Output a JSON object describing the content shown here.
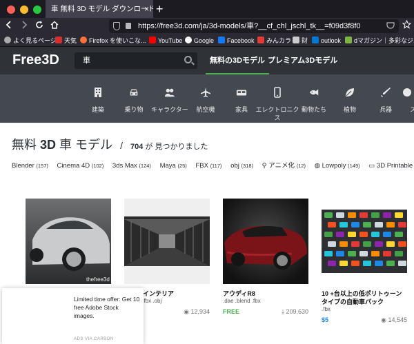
{
  "browser": {
    "tab_title": "車 無料 3D モデル ダウンロード - Fr",
    "tab_close": "×",
    "new_tab": "+",
    "url": "https://free3d.com/ja/3d-models/車?__cf_chl_jschl_tk__=f09d3f8f0",
    "colors": {
      "red": "#ff5f57",
      "yellow": "#febc2e",
      "green": "#28c840"
    }
  },
  "bookmarks": [
    {
      "label": "よく見るページ",
      "icon": "gear-icon",
      "color": "#aaaaaa"
    },
    {
      "label": "天気",
      "icon": "weather-icon",
      "color": "#d32f2f"
    },
    {
      "label": "Firefox を使いこな...",
      "icon": "firefox-icon",
      "color": "#ff7139"
    },
    {
      "label": "YouTube",
      "icon": "youtube-icon",
      "color": "#ff0000"
    },
    {
      "label": "Google",
      "icon": "google-icon",
      "color": "#ffffff"
    },
    {
      "label": "Facebook",
      "icon": "facebook-icon",
      "color": "#1877f2"
    },
    {
      "label": "みんカラ",
      "icon": "minkara-icon",
      "color": "#e53935"
    },
    {
      "label": "財",
      "icon": "folder-icon",
      "color": "#cccccc"
    },
    {
      "label": "outlook",
      "icon": "outlook-icon",
      "color": "#0078d4"
    },
    {
      "label": "dマガジン｜多彩なジ...",
      "icon": "dmagazine-icon",
      "color": "#7cb342"
    }
  ],
  "site": {
    "logo": "Free3D",
    "search_query": "車",
    "nav": [
      "無料の3Dモデル",
      "プレミアム3Dモデル"
    ],
    "accent": "#4caf50"
  },
  "categories": [
    {
      "label": "建築",
      "icon": "building-icon"
    },
    {
      "label": "乗り物",
      "icon": "car-icon"
    },
    {
      "label": "キャラクター",
      "icon": "people-icon"
    },
    {
      "label": "航空機",
      "icon": "airplane-icon"
    },
    {
      "label": "家具",
      "icon": "bed-icon"
    },
    {
      "label": "エレクトロニクス",
      "icon": "phone-icon"
    },
    {
      "label": "動物たち",
      "icon": "fish-icon"
    },
    {
      "label": "植物",
      "icon": "leaf-icon"
    },
    {
      "label": "兵器",
      "icon": "weapon-icon"
    },
    {
      "label": "ス",
      "icon": "sports-icon"
    }
  ],
  "heading": {
    "title_prefix": "無料 ",
    "title_bold": "3D",
    "title_suffix": " 車 モデル",
    "slash": "/",
    "count": "704",
    "found_text": " が 見つかりました"
  },
  "filters": [
    {
      "label": "Blender",
      "count": "(157)",
      "icon": ""
    },
    {
      "label": "Cinema 4D",
      "count": "(102)",
      "icon": ""
    },
    {
      "label": "3ds Max",
      "count": "(124)",
      "icon": ""
    },
    {
      "label": "Maya",
      "count": "(25)",
      "icon": ""
    },
    {
      "label": "FBX",
      "count": "(117)",
      "icon": ""
    },
    {
      "label": "obj",
      "count": "(318)",
      "icon": ""
    },
    {
      "label": "アニメ化",
      "count": "(12)",
      "icon": "running-icon"
    },
    {
      "label": "Lowpoly",
      "count": "(149)",
      "icon": "globe-icon"
    },
    {
      "label": "3D Printable",
      "count": "(",
      "icon": "monitor-icon"
    }
  ],
  "cards": [
    {
      "title": "",
      "formats": "",
      "price": "",
      "views": "",
      "watermark": "thefree3d"
    },
    {
      "title": "電車のインテリア",
      "formats": "vn .ma .fbx .obj",
      "price": "",
      "views": "12,934"
    },
    {
      "title": "アウディR8",
      "formats": ".dae .blend .fbx",
      "price": "FREE",
      "views": "209,630"
    },
    {
      "title": "10 +台以上の低ポリトゥーンタイプの自動車パック",
      "formats": ".fbx",
      "price": "$5",
      "views": "14,545"
    }
  ],
  "ad": {
    "text": "Limited time offer: Get 10 free Adobe Stock images.",
    "label": "ADS VIA CARBON"
  }
}
